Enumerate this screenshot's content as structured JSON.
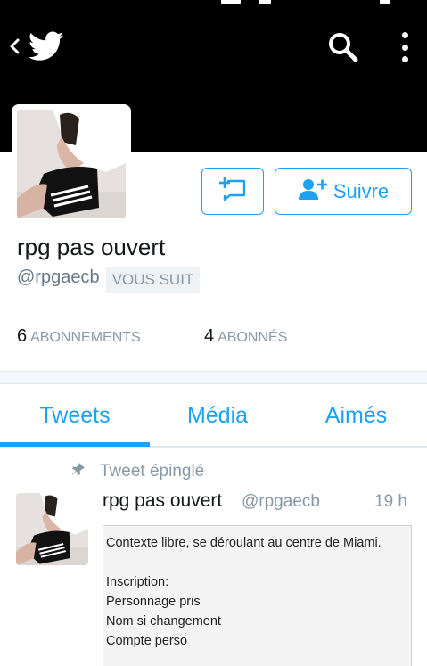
{
  "header": {
    "icons": [
      "back-chevron-icon",
      "twitter-bird-icon",
      "search-icon",
      "more-vertical-icon"
    ],
    "background_color": "#000000"
  },
  "profile": {
    "display_name": "rpg pas ouvert",
    "handle": "@rpgaecb",
    "follows_you_badge": "VOUS SUIT",
    "avatar_icon": "profile-photo",
    "actions": {
      "dm_icon": "direct-message-icon",
      "follow_label": "Suivre",
      "follow_icon": "add-user-icon"
    },
    "stats": {
      "following_count": "6",
      "following_label": "ABONNEMENTS",
      "followers_count": "4",
      "followers_label": "ABONNÉS"
    }
  },
  "tabs": [
    {
      "label": "Tweets",
      "active": true
    },
    {
      "label": "Média",
      "active": false
    },
    {
      "label": "Aimés",
      "active": false
    }
  ],
  "pinned_tweet": {
    "pinned_label": "Tweet épinglé",
    "author_name": "rpg pas ouvert",
    "author_handle": "@rpgaecb",
    "time": "19 h",
    "image_text": {
      "line1": "Contexte libre, se déroulant au centre de Miami.",
      "line2": "Inscription:",
      "line3": "Personnage pris",
      "line4": "Nom si changement",
      "line5": "Compte perso"
    }
  },
  "colors": {
    "accent": "#1da1f2",
    "secondary_text": "#8899a6",
    "primary_text": "#14171a"
  }
}
